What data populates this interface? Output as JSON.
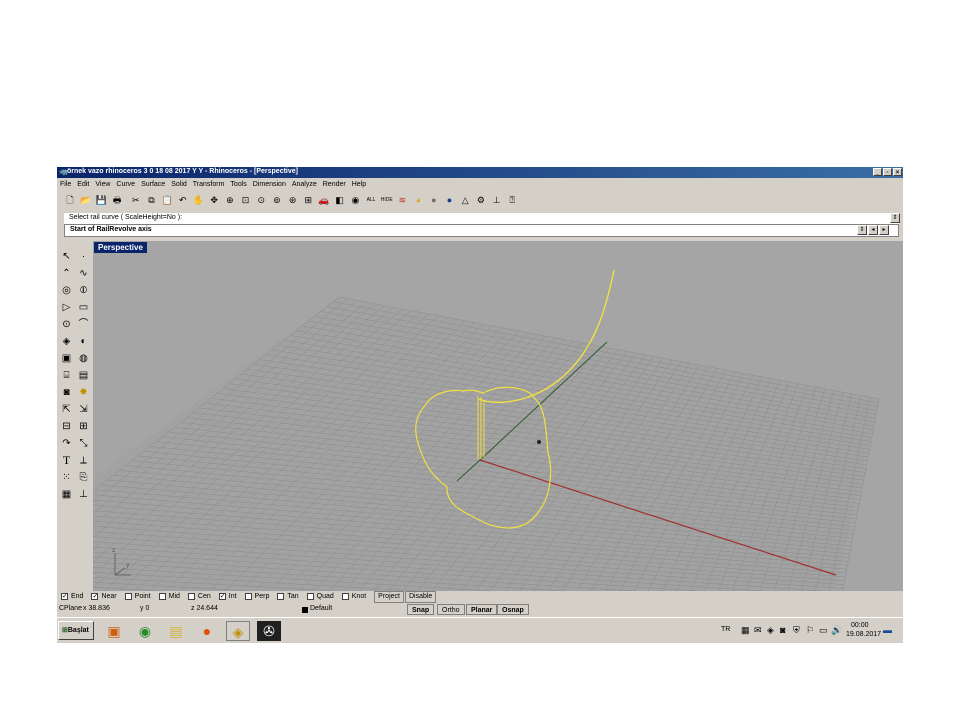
{
  "window": {
    "title": "örnek vazo rhinoceros 3 0 18 08 2017 Y Y - Rhinoceros - [Perspective]",
    "controls": [
      "_",
      "▫",
      "×"
    ]
  },
  "menu": [
    "File",
    "Edit",
    "View",
    "Curve",
    "Surface",
    "Solid",
    "Transform",
    "Tools",
    "Dimension",
    "Analyze",
    "Render",
    "Help"
  ],
  "toolbar": {
    "icons": [
      "new-icon",
      "open-icon",
      "save-icon",
      "print-icon",
      "cut-icon",
      "copy-icon",
      "paste-icon",
      "undo-icon",
      "pan-icon",
      "rotate-view-icon",
      "zoom-dynamic-icon",
      "zoom-window-icon",
      "zoom-extents-icon",
      "zoom-selected-icon",
      "zoom-target-icon",
      "four-views-icon",
      "car-icon",
      "layer-icon",
      "object-properties-icon",
      "show-all-icon",
      "hide-icon",
      "layers-stack-icon",
      "color-wheel-icon",
      "sphere-grey-icon",
      "sphere-blue-icon",
      "light-icon",
      "gear-icon",
      "dimension-icon",
      "help-icon"
    ],
    "all_label": "ALL",
    "hide_label": "HIDE"
  },
  "command": {
    "history": "Select rail curve ( ScaleHeight=No ):",
    "prompt": "Start of RailRevolve axis"
  },
  "viewport": {
    "title": "Perspective"
  },
  "left_toolbar": {
    "icons": [
      "select-arrow-icon",
      "point-icon",
      "polyline-icon",
      "curve-from-points-icon",
      "circle-icon",
      "ellipse-icon",
      "polygon-icon",
      "rectangle-icon",
      "arc-icon",
      "fillet-icon",
      "surface-icon",
      "network-surface-icon",
      "box-icon",
      "sphere-icon",
      "cylinder-icon",
      "boolean-icon",
      "mesh-icon",
      "explode-icon",
      "transform-icon",
      "move-icon",
      "array-icon",
      "grid-icon",
      "rotate-icon",
      "scale-icon",
      "text-icon",
      "dimension-icon",
      "group-icon",
      "block-icon",
      "layout-icon",
      "options-icon"
    ],
    "text_tool": "T"
  },
  "osnap": {
    "items": [
      {
        "label": "End",
        "checked": true
      },
      {
        "label": "Near",
        "checked": true
      },
      {
        "label": "Point",
        "checked": false
      },
      {
        "label": "Mid",
        "checked": false
      },
      {
        "label": "Cen",
        "checked": false
      },
      {
        "label": "Int",
        "checked": true
      },
      {
        "label": "Perp",
        "checked": false
      },
      {
        "label": "Tan",
        "checked": false
      },
      {
        "label": "Quad",
        "checked": false
      },
      {
        "label": "Knot",
        "checked": false
      }
    ],
    "project_label": "Project",
    "disable_label": "Disable"
  },
  "status": {
    "cplane": "CPlane",
    "x": "x 38.836",
    "y": "y 0",
    "z": "z 24.644",
    "layer": "Default",
    "snap": "Snap",
    "ortho": "Ortho",
    "planar": "Planar",
    "osnap": "Osnap"
  },
  "taskbar": {
    "start_label": "Başlat",
    "apps": [
      "media-player-icon",
      "chrome-icon",
      "file-explorer-icon",
      "firefox-icon",
      "rhino-icon",
      "app-icon"
    ],
    "language": "TR",
    "time": "00:00",
    "date": "19.08.2017"
  },
  "scene": {
    "grid_color": "#8a8a8a",
    "x_axis_color": "#a03030",
    "y_axis_color": "#2c5a2c",
    "curve_color": "#f0e040",
    "background": "#a5a5a5"
  }
}
